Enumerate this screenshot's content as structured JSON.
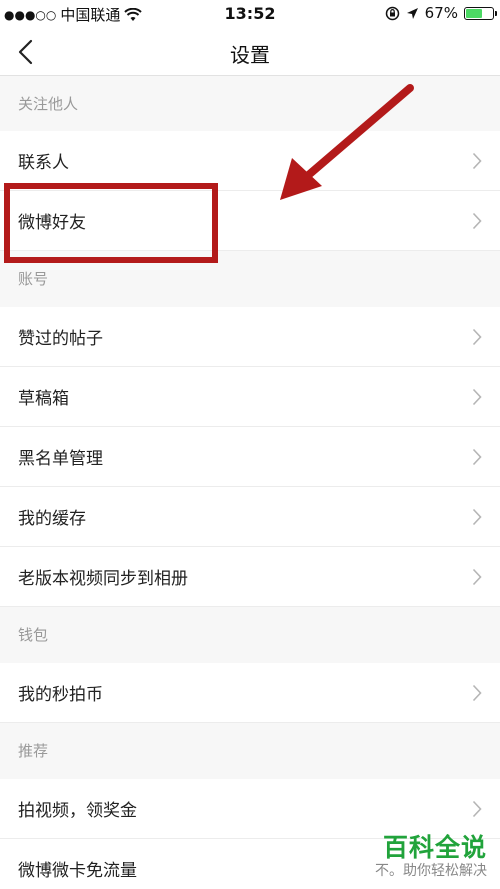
{
  "status_bar": {
    "carrier": "中国联通",
    "time": "13:52",
    "battery_percent": "67%",
    "battery_level": 0.67,
    "icons": [
      "signal-dots-icon",
      "wifi-icon",
      "rotation-lock-icon",
      "location-arrow-icon",
      "battery-icon"
    ]
  },
  "nav": {
    "title": "设置",
    "back_icon": "chevron-left-icon"
  },
  "sections": [
    {
      "header": "关注他人",
      "items": [
        {
          "label": "联系人"
        },
        {
          "label": "微博好友"
        }
      ]
    },
    {
      "header": "账号",
      "items": [
        {
          "label": "赞过的帖子"
        },
        {
          "label": "草稿箱"
        },
        {
          "label": "黑名单管理"
        },
        {
          "label": "我的缓存"
        },
        {
          "label": "老版本视频同步到相册"
        }
      ]
    },
    {
      "header": "钱包",
      "items": [
        {
          "label": "我的秒拍币"
        }
      ]
    },
    {
      "header": "推荐",
      "items": [
        {
          "label": "拍视频，领奖金"
        },
        {
          "label": "微博微卡免流量"
        }
      ]
    }
  ],
  "annotation": {
    "color": "#b31a1a",
    "highlighted_item": "微博好友"
  },
  "watermark": {
    "title": "百科全说",
    "subtitle": "不。助你轻松解决",
    "color": "#21a33b"
  }
}
